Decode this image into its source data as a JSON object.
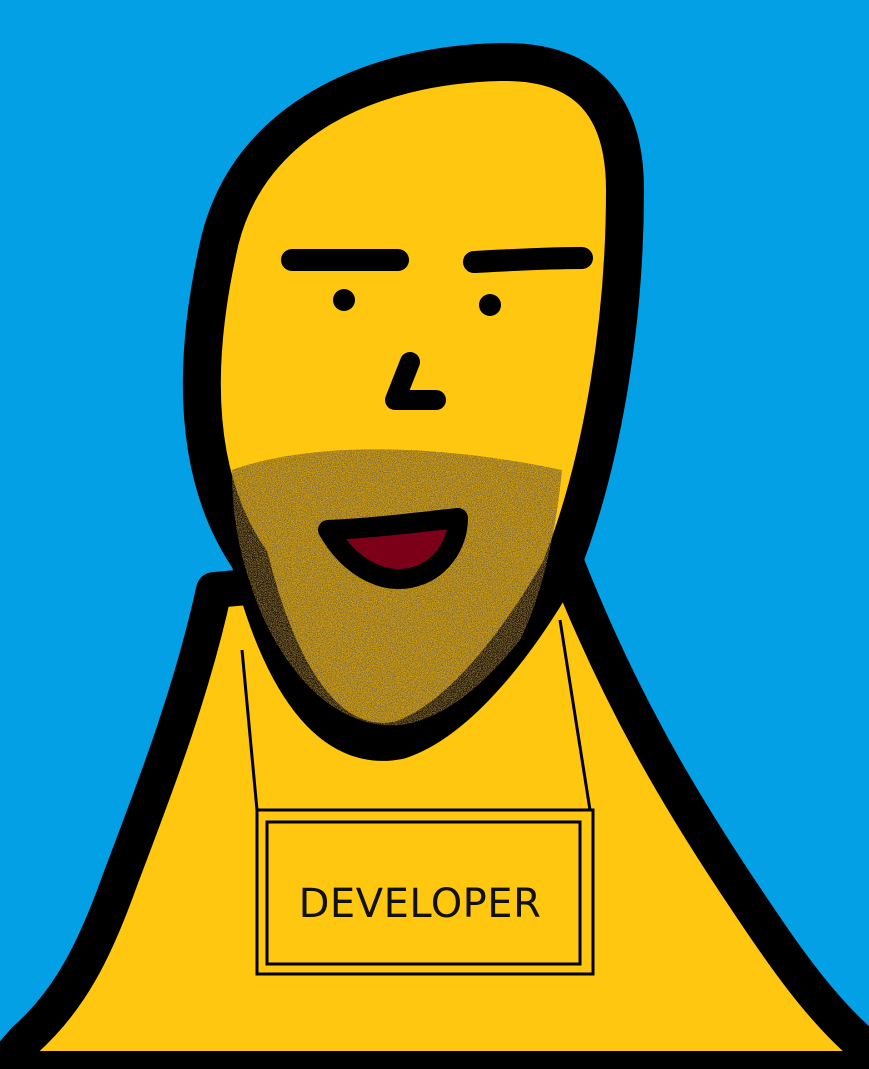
{
  "badge": {
    "text": "DEVELOPER"
  },
  "colors": {
    "background": "#03a0e6",
    "skin": "#ffc70f",
    "outline": "#000000",
    "mouth": "#7d0019",
    "stubble": "#6b4a12"
  },
  "icons": {
    "figure": "cartoon-developer-figure",
    "beard": "stubble-icon"
  }
}
